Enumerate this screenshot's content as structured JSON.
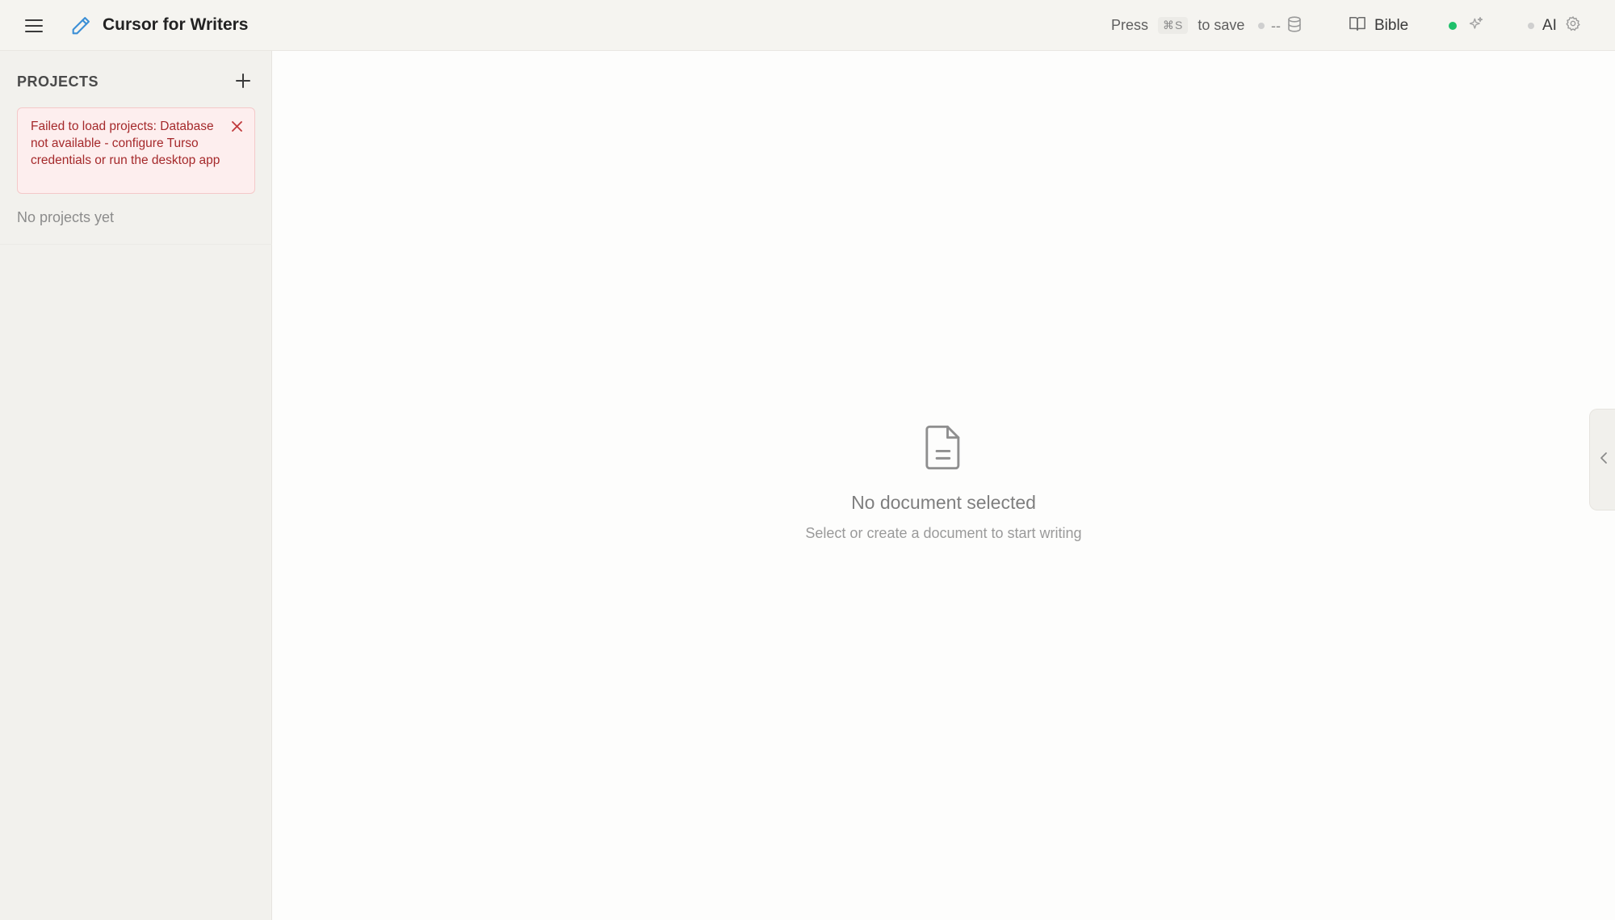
{
  "header": {
    "title": "Cursor for Writers",
    "save_hint": {
      "prefix": "Press",
      "shortcut": "⌘S",
      "suffix": "to save"
    },
    "db_status_text": "--",
    "bible_label": "Bible",
    "ai_label": "AI"
  },
  "icons": {
    "menu": "hamburger-menu-icon",
    "logo": "pencil-icon",
    "database": "database-icon",
    "bible": "book-open-icon",
    "ai_spark": "sparkles-icon",
    "settings": "gear-icon",
    "add": "plus-icon",
    "close": "close-icon",
    "document": "file-text-icon",
    "collapse": "chevron-left-icon"
  },
  "sidebar": {
    "title": "PROJECTS",
    "error_message": "Failed to load projects: Database not available - configure Turso credentials or run the desktop app",
    "empty_text": "No projects yet"
  },
  "main": {
    "empty_title": "No document selected",
    "empty_subtitle": "Select or create a document to start writing"
  },
  "colors": {
    "accent": "#3b8fd6",
    "online": "#1ec06a",
    "error_text": "#a5292b",
    "error_bg": "#fdeeee"
  }
}
